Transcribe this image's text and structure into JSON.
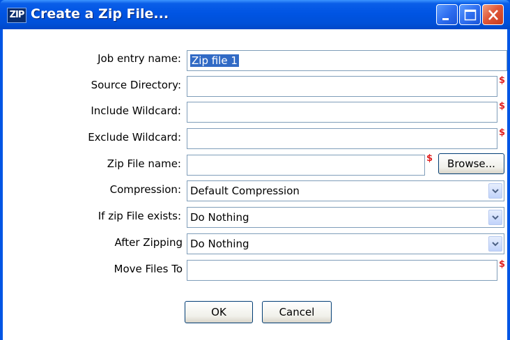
{
  "window": {
    "title": "Create a Zip File...",
    "icon_text": "ZIP"
  },
  "form": {
    "job_entry_name": {
      "label": "Job entry name:",
      "value": "Zip file 1"
    },
    "source_directory": {
      "label": "Source Directory:",
      "value": ""
    },
    "include_wildcard": {
      "label": "Include Wildcard:",
      "value": ""
    },
    "exclude_wildcard": {
      "label": "Exclude Wildcard:",
      "value": ""
    },
    "zip_file_name": {
      "label": "Zip File name:",
      "value": "",
      "browse_label": "Browse..."
    },
    "compression": {
      "label": "Compression:",
      "value": "Default Compression"
    },
    "if_zip_exists": {
      "label": "If zip File exists:",
      "value": "Do Nothing"
    },
    "after_zipping": {
      "label": "After Zipping",
      "value": "Do Nothing"
    },
    "move_files_to": {
      "label": "Move Files To",
      "value": ""
    },
    "variable_marker": "$"
  },
  "buttons": {
    "ok": "OK",
    "cancel": "Cancel"
  },
  "colors": {
    "title_bar": "#0054e3",
    "selection": "#316ac5",
    "variable_marker": "#e02020"
  }
}
